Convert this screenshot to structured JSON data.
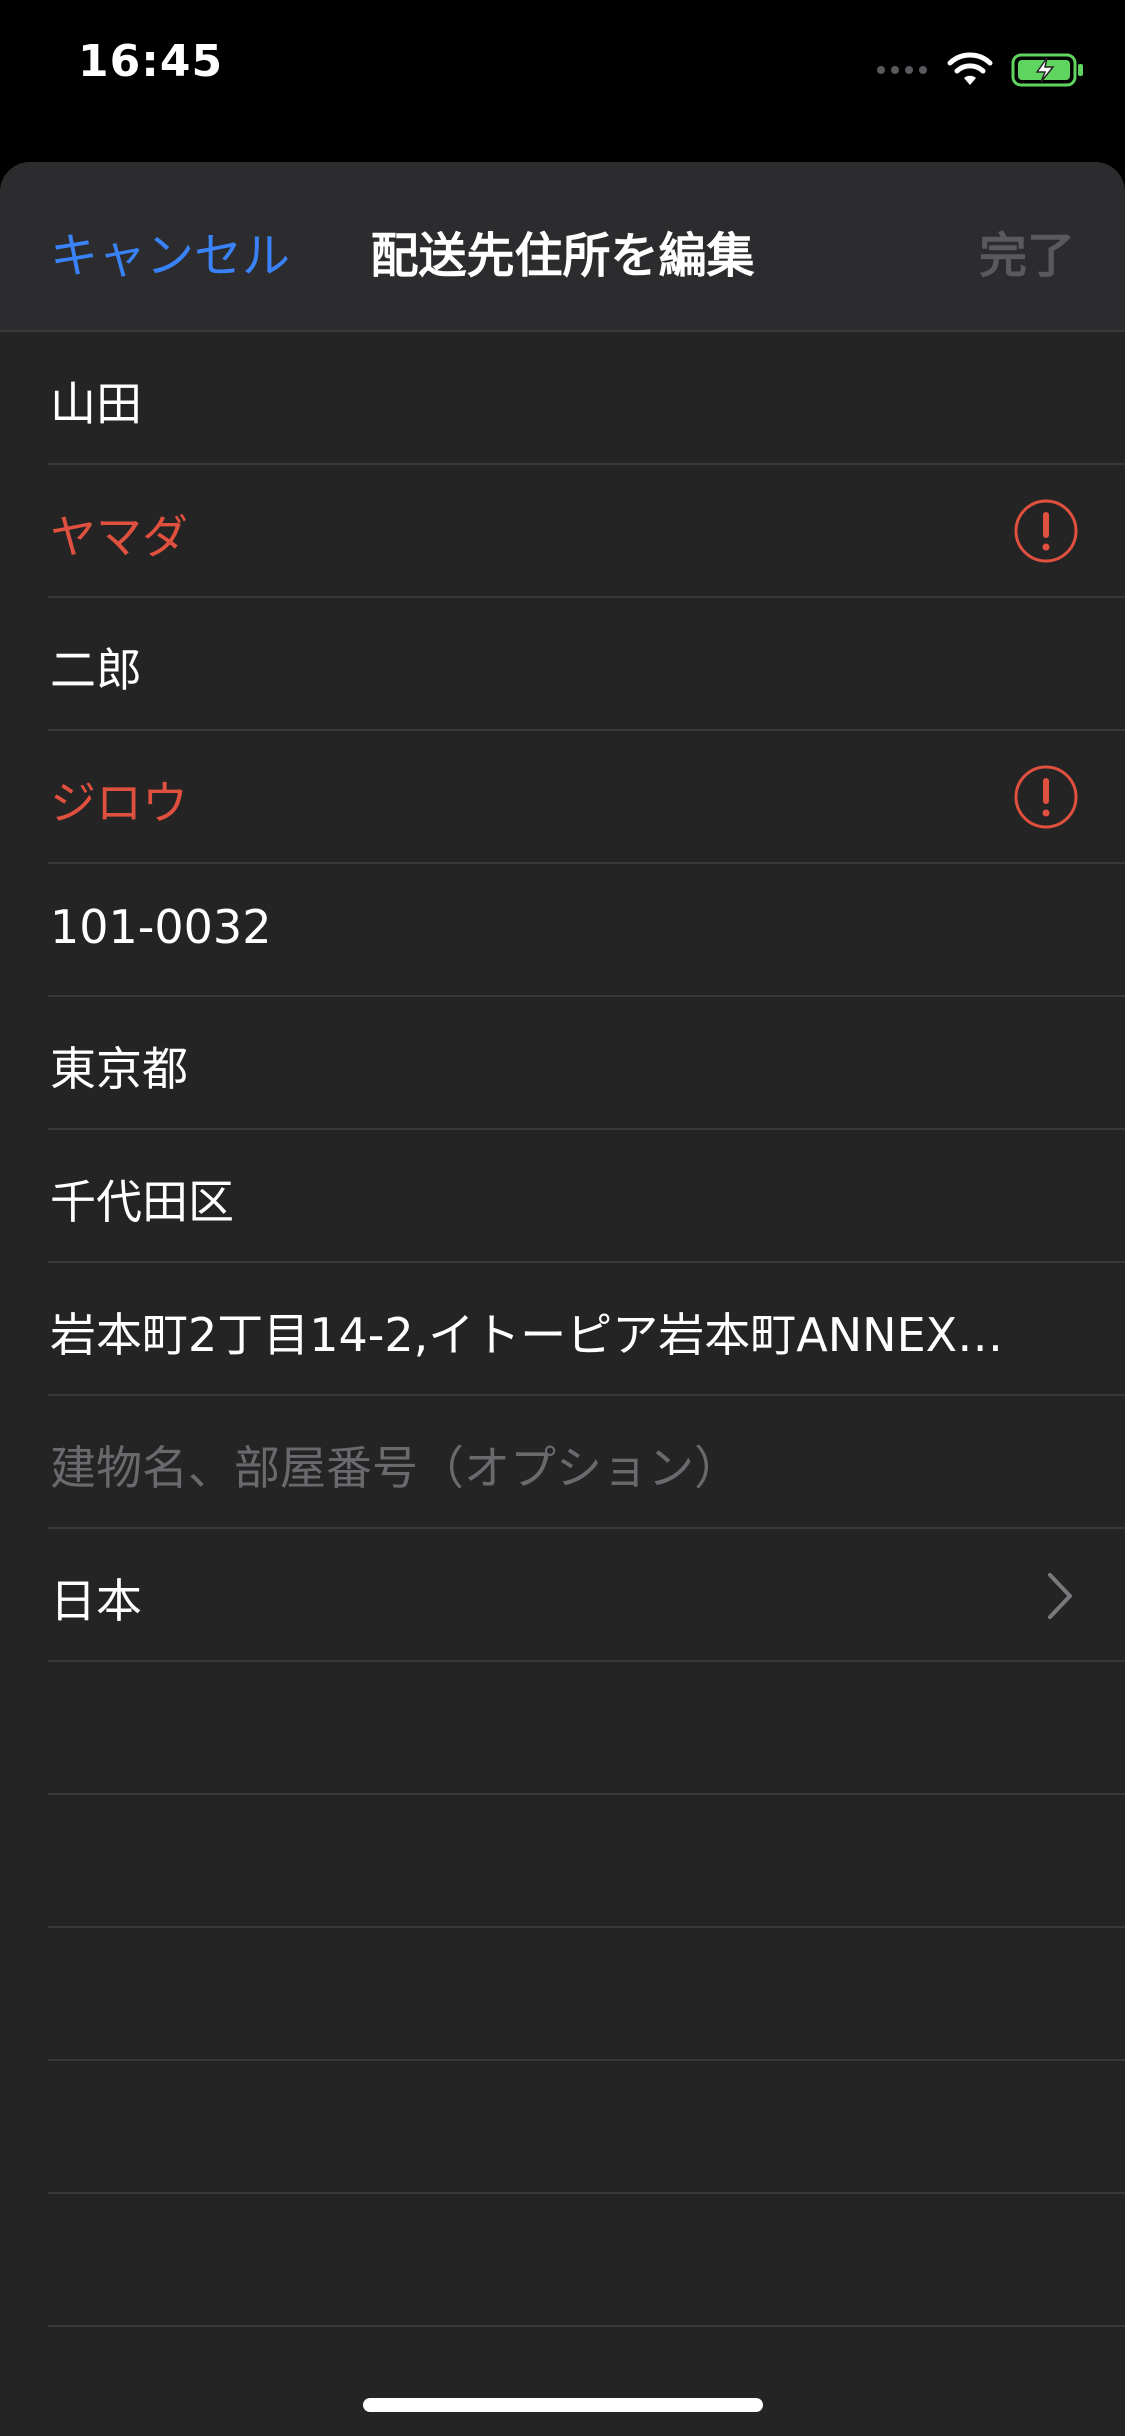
{
  "status_bar": {
    "time": "16:45",
    "battery_color": "#5fd55f",
    "icons": [
      "signal-icon",
      "wifi-icon",
      "battery-charging-icon"
    ]
  },
  "nav": {
    "cancel_label": "キャンセル",
    "title": "配送先住所を編集",
    "done_label": "完了",
    "cancel_color": "#3a82f7",
    "done_color": "#5a5a5e"
  },
  "form": {
    "last_name": "山田",
    "last_name_kana": "ヤマダ",
    "first_name": "二郎",
    "first_name_kana": "ジロウ",
    "postal_code": "101-0032",
    "prefecture": "東京都",
    "city": "千代田区",
    "address": "岩本町2丁目14-2,イトーピア岩本町ANNEX…",
    "building_placeholder": "建物名、部屋番号（オプション）",
    "country": "日本",
    "error_color": "#e0503f"
  }
}
